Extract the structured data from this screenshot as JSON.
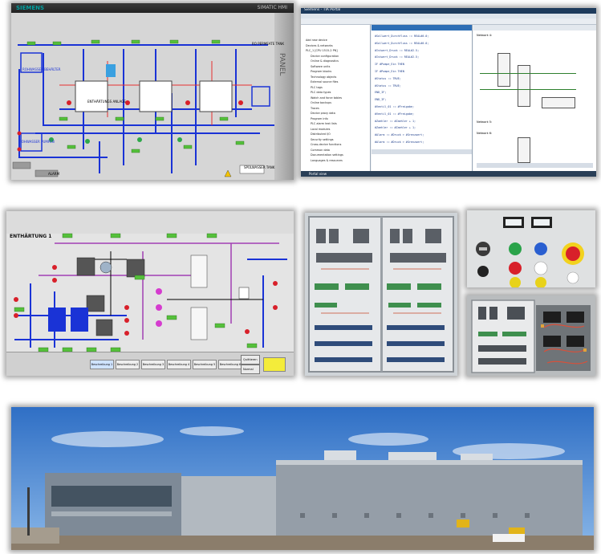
{
  "hmi1": {
    "brand": "SIEMENS",
    "model": "SIMATIC HMI",
    "badge": "PANEL",
    "labels": [
      "ROHWASSER BEHÄLTER",
      "ENTHÄRTUNGS ANLAGE",
      "RO PERMEATE TANK",
      "ROHWASSER PUMPEN",
      "SPÜLWASSER TANK",
      "ALARM"
    ]
  },
  "ide": {
    "title": "Siemens - TIA Portal",
    "tree_items": [
      "Add new device",
      "Devices & networks",
      "PLC_1 [CPU 1515-2 PN]",
      "Device configuration",
      "Online & diagnostics",
      "Software units",
      "Program blocks",
      "Technology objects",
      "External source files",
      "PLC tags",
      "PLC data types",
      "Watch and force tables",
      "Online backups",
      "Traces",
      "Device proxy data",
      "Program info",
      "PLC alarm text lists",
      "Local modules",
      "Distributed I/O",
      "Security settings",
      "Cross-device functions",
      "Common data",
      "Documentation settings",
      "Languages & resources"
    ],
    "code_lines": [
      "#Sollwert_Durchfluss := REAL#0.0;",
      "#Istwert_Druck := REAL#2.5;",
      "IF #Pumpe_Ein THEN",
      "#Status := TRUE;",
      "END_IF;",
      "#Ventil_01 := #Freigabe;",
      "#Zaehler := #Zaehler + 1;",
      "#Alarm := #Druck > #Grenzwert;"
    ],
    "network_labels": [
      "Network 4:",
      "Network 5:",
      "Network 6:"
    ],
    "statusbar": "Portal view"
  },
  "hmi2": {
    "title": "ENTHÄRTUNG 1",
    "buttons": [
      "Beschreibung 1",
      "Beschreibung 2",
      "Beschreibung 3",
      "Beschreibung 4",
      "Beschreibung 5",
      "Beschreibung 6"
    ],
    "right_buttons": [
      "Quittieren",
      "Normal"
    ]
  },
  "colors": {
    "hmi_bg": "#d9d9d9",
    "pipe_blue": "#1a33d6",
    "pipe_purple": "#a23fb3",
    "value_green": "#55c03b",
    "alarm_red": "#d8202a",
    "sky": "#4d8ed6",
    "building": "#9aa3ad"
  },
  "icons": [
    "emergency-stop-icon",
    "key-switch-icon",
    "indicator-lamp-icon"
  ]
}
